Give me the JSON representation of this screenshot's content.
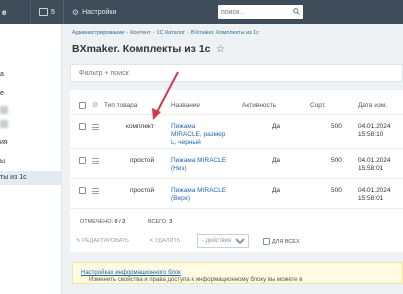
{
  "topbar": {
    "logo": "е",
    "notifications_count": "5",
    "settings_label": "Настройки",
    "search_placeholder": "поиск..."
  },
  "sidebar": {
    "fragments": [
      "а",
      "е",
      "ия",
      "ы"
    ],
    "active_item": "ты из 1с"
  },
  "breadcrumb": [
    "Администрирование",
    "Контент",
    "1С Каталог",
    "BXmaker. Комплекты из 1с"
  ],
  "page_title": "BXmaker. Комплекты из 1с",
  "filter_placeholder": "Фильтр + поиск",
  "table": {
    "headers": {
      "type": "Тип товара",
      "name": "Название",
      "active": "Активность",
      "sort": "Сорт.",
      "date": "Дата изм."
    },
    "rows": [
      {
        "type": "комплект",
        "name_l1": "Пижама",
        "name_l2": "MIRACLE, размер",
        "name_l3": "L, черный",
        "active": "Да",
        "sort": "500",
        "date": "04.01.2024",
        "time": "15:58:10"
      },
      {
        "type": "простой",
        "name_l1": "Пижама MIRACLE",
        "name_l2": "(Низ)",
        "name_l3": "",
        "active": "Да",
        "sort": "500",
        "date": "04.01.2024",
        "time": "15:58:01"
      },
      {
        "type": "простой",
        "name_l1": "Пижама MIRACLE",
        "name_l2": "(Верх)",
        "name_l3": "",
        "active": "Да",
        "sort": "500",
        "date": "04.01.2024",
        "time": "15:58:01"
      }
    ],
    "selected_label": "ОТМЕЧЕНО:",
    "selected_value": "0 / 3",
    "total_label": "ВСЕГО:",
    "total_value": "3"
  },
  "actions": {
    "edit": "РЕДАКТИРОВАТЬ",
    "delete": "УДАЛИТЬ",
    "select_value": "- действия -",
    "for_all": "ДЛЯ ВСЕХ"
  },
  "notice": {
    "text": "Изменить свойства и права доступа к информационному блоку вы можете в",
    "link": "Настройках информационного блок"
  },
  "colors": {
    "topbar": "#3f4c5a",
    "link": "#2067b0",
    "arrow": "#d03c4c",
    "notice_bg": "#fefbe2"
  }
}
